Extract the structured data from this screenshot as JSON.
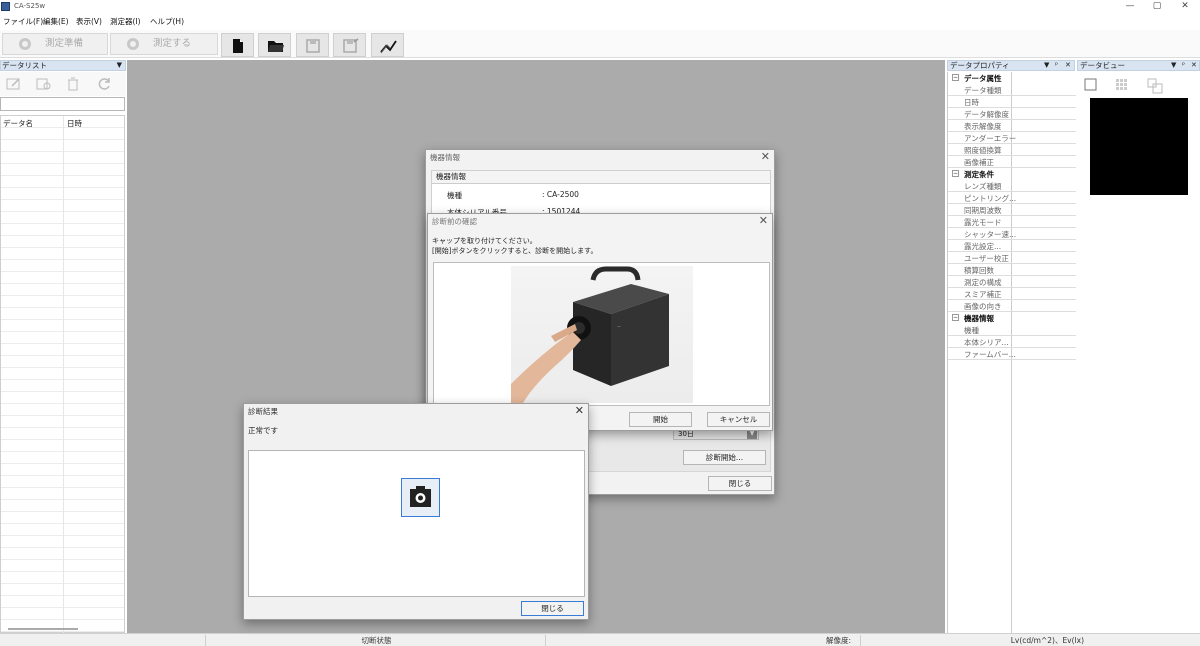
{
  "window": {
    "title": "CA-S25w",
    "controls": [
      "—",
      "▢",
      "✕"
    ]
  },
  "menu": [
    "ファイル(F)",
    "編集(E)",
    "表示(V)",
    "測定器(I)",
    "ヘルプ(H)"
  ],
  "toolbar": {
    "prepare_label": "測定準備",
    "measure_label": "測定する"
  },
  "datalist": {
    "title": "データリスト",
    "columns": [
      "データ名",
      "日時"
    ]
  },
  "properties": {
    "title": "データプロパティ",
    "categories": [
      {
        "name": "データ属性",
        "items": [
          "データ種類",
          "日時",
          "データ解像度",
          "表示解像度",
          "アンダーエラー",
          "照度値換算",
          "画像補正"
        ]
      },
      {
        "name": "測定条件",
        "items": [
          "レンズ種類",
          "ピントリング...",
          "同期周波数",
          "露光モード",
          "シャッター速...",
          "露光設定...",
          "ユーザー校正",
          "積算回数",
          "測定の構成",
          "スミア補正",
          "画像の向き"
        ]
      },
      {
        "name": "機器情報",
        "items": [
          "機種",
          "本体シリア...",
          "ファームバー..."
        ]
      }
    ]
  },
  "dataview": {
    "title": "データビュー"
  },
  "statusbar": {
    "connection": "切断状態",
    "resolution": "解像度:",
    "units": "Lv(cd/m^2)、Ev(lx)"
  },
  "device_info_dialog": {
    "title": "機器情報",
    "group_title": "機器情報",
    "rows": [
      {
        "label": "機種",
        "value": ": CA-2500"
      },
      {
        "label": "本体シリアル番号",
        "value": ": 1501244"
      }
    ],
    "select_value": "30日",
    "diag_start_button": "診断開始...",
    "close_button": "閉じる"
  },
  "confirm_dialog": {
    "title": "診断前の確認",
    "message_line1": "キャップを取り付けてください。",
    "message_line2": "[開始]ボタンをクリックすると、診断を開始します。",
    "start_button": "開始",
    "cancel_button": "キャンセル"
  },
  "result_dialog": {
    "title": "診断結果",
    "status": "正常です",
    "close_button": "閉じる"
  }
}
